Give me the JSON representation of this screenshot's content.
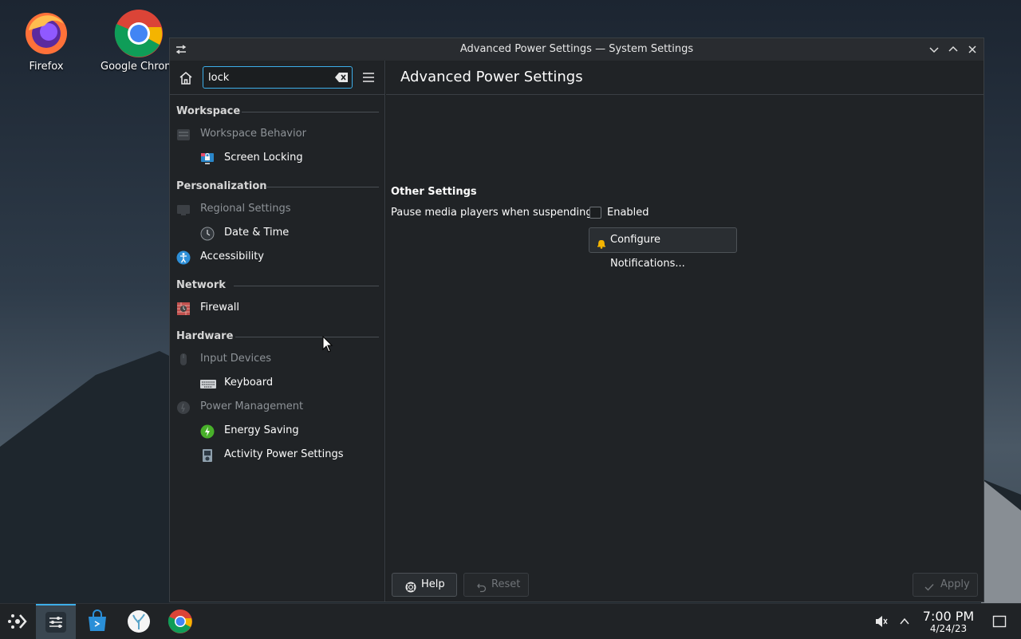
{
  "desktop": {
    "icons": [
      {
        "label": "Firefox"
      },
      {
        "label": "Google Chrome"
      }
    ]
  },
  "window": {
    "title": "Advanced Power Settings — System Settings"
  },
  "sidebar": {
    "search_value": "lock",
    "sections": [
      {
        "title": "Workspace",
        "items": [
          {
            "label": "Workspace Behavior",
            "dim": true
          },
          {
            "label": "Screen Locking"
          }
        ]
      },
      {
        "title": "Personalization",
        "items": [
          {
            "label": "Regional Settings",
            "dim": true
          },
          {
            "label": "Date & Time"
          },
          {
            "label": "Accessibility"
          }
        ]
      },
      {
        "title": "Network",
        "items": [
          {
            "label": "Firewall"
          }
        ]
      },
      {
        "title": "Hardware",
        "items": [
          {
            "label": "Input Devices",
            "dim": true
          },
          {
            "label": "Keyboard"
          },
          {
            "label": "Power Management",
            "dim": true
          },
          {
            "label": "Energy Saving"
          },
          {
            "label": "Activity Power Settings"
          }
        ]
      }
    ]
  },
  "content": {
    "header": "Advanced Power Settings",
    "other_settings_title": "Other Settings",
    "pause_media_label": "Pause media players when suspending:",
    "pause_media_checkbox_label": "Enabled",
    "pause_media_checked": false,
    "configure_notifications_label": "Configure Notifications...",
    "help_label": "Help",
    "reset_label": "Reset",
    "apply_label": "Apply"
  },
  "taskbar": {
    "time": "7:00 PM",
    "date": "4/24/23"
  },
  "colors": {
    "accent": "#3daee9",
    "window_bg": "#202326",
    "titlebar_bg": "#292c30"
  }
}
